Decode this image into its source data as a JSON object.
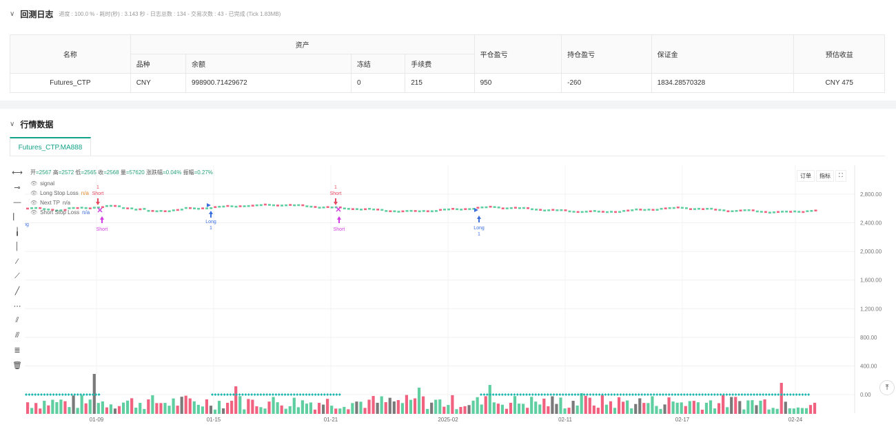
{
  "log": {
    "title": "回测日志",
    "meta": "进度 : 100.0 % - 耗时(秒) : 3.143 秒 - 日志总数 : 134 - 交易次数 : 43 - 已完成 (Tick 1.83MB)"
  },
  "assets_table": {
    "h_name": "名称",
    "h_asset": "资产",
    "h_variety": "品种",
    "h_balance": "余额",
    "h_frozen": "冻结",
    "h_fee": "手续费",
    "h_close_pnl": "平仓盈亏",
    "h_hold_pnl": "持仓盈亏",
    "h_margin": "保证金",
    "h_est": "预估收益",
    "row": {
      "name": "Futures_CTP",
      "variety": "CNY",
      "balance": "998900.71429672",
      "frozen": "0",
      "fee": "215",
      "close_pnl": "950",
      "hold_pnl": "-260",
      "margin": "1834.28570328",
      "est": "CNY 475"
    }
  },
  "market": {
    "title": "行情数据",
    "tab": "Futures_CTP.MA888",
    "ohlc": {
      "open_k": "开",
      "open": "2567",
      "high_k": "高",
      "high": "2572",
      "low_k": "低",
      "low": "2565",
      "close_k": "收",
      "close": "2568",
      "vol_k": "量",
      "vol": "57620",
      "chg_k": "涨跌幅",
      "chg": "0.04%",
      "amp_k": "振幅",
      "amp": "0.27%"
    },
    "legend": [
      {
        "label": "signal",
        "value": ""
      },
      {
        "label": "Long Stop Loss",
        "value": "n/a"
      },
      {
        "label": "Next TP",
        "value": "n/a"
      },
      {
        "label": "Short Stop Loss",
        "value": "n/a"
      }
    ],
    "buttons": {
      "order": "订单",
      "indicator": "指标",
      "fullscreen": "⛶"
    },
    "scroll_top": "⤒"
  },
  "chart_data": {
    "type": "candlestick",
    "ylim": [
      0,
      3200
    ],
    "y_ticks": [
      "2,800.00",
      "2,400.00",
      "2,000.00",
      "1,600.00",
      "1,200.00",
      "800.00",
      "400.00",
      "0.00"
    ],
    "y_tick_values": [
      2800,
      2400,
      2000,
      1600,
      1200,
      800,
      400,
      0
    ],
    "x_ticks": [
      "01-09",
      "01-15",
      "01-21",
      "2025-02",
      "02-11",
      "02-17",
      "02-24"
    ],
    "price_series": [
      2600,
      2590,
      2580,
      2600,
      2610,
      2620,
      2630,
      2610,
      2590,
      2560,
      2570,
      2580,
      2600,
      2610,
      2620,
      2630,
      2640,
      2640,
      2650,
      2650,
      2640,
      2630,
      2620,
      2610,
      2600,
      2590,
      2580,
      2570,
      2560,
      2560,
      2570,
      2580,
      2590,
      2600,
      2610,
      2620,
      2610,
      2600,
      2590,
      2580,
      2570,
      2560,
      2560,
      2550,
      2560,
      2570,
      2580,
      2590,
      2600,
      2610,
      2600,
      2590,
      2580,
      2570,
      2570,
      2560,
      2550,
      2550,
      2560,
      2570
    ],
    "signals": [
      {
        "type": "Short",
        "qty": "1",
        "label_top": "1\nShort",
        "at": "01-09"
      },
      {
        "type": "Short",
        "at": "01-09",
        "label": "Short"
      },
      {
        "type": "Long",
        "qty": "1",
        "at": "01-15",
        "label": "Long\n1"
      },
      {
        "type": "Short",
        "qty": "1",
        "at": "01-21",
        "label_top": "1\nShort"
      },
      {
        "type": "Short",
        "at": "01-21",
        "label": "Short"
      },
      {
        "type": "Long",
        "qty": "1",
        "at": "2025-02",
        "label": "Long\n1"
      }
    ],
    "colors": {
      "up": "#5fcfa1",
      "down": "#f0627f",
      "neutral": "#7a7a7a",
      "signal_dots": "#1fb8b0",
      "long": "#3b6fe0",
      "short_top": "#e8485f",
      "short_bottom": "#d03ce0"
    }
  }
}
